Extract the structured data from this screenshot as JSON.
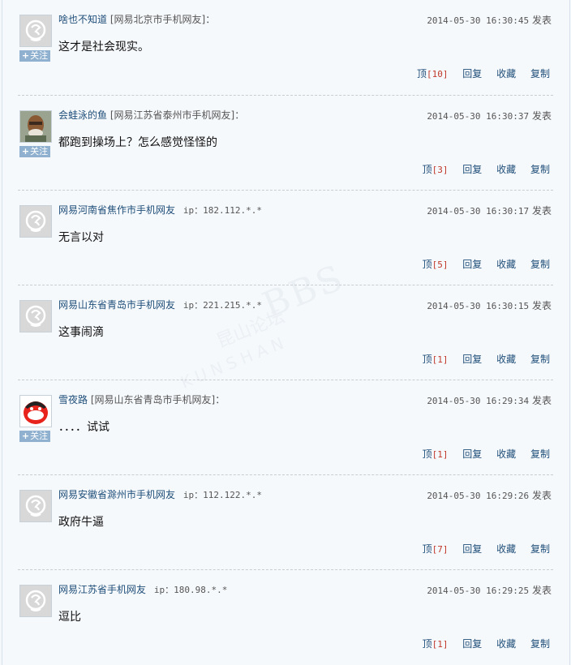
{
  "follow_label": "关注",
  "vote_label": "顶",
  "reply_label": "回复",
  "fav_label": "收藏",
  "copy_label": "复制",
  "post_suffix": "发表",
  "watermark": {
    "brand": "BBS",
    "cn": "昆山论坛",
    "en": "KUNSHAN"
  },
  "comments": [
    {
      "user": "啥也不知道",
      "loc": "[网易北京市手机网友]：",
      "ip": "",
      "time": "2014-05-30 16:30:45",
      "text": "这才是社会现实。",
      "votes": "10",
      "avatar": "default",
      "follow": true
    },
    {
      "user": "会蛙泳的鱼",
      "loc": "[网易江苏省泰州市手机网友]：",
      "ip": "",
      "time": "2014-05-30 16:30:37",
      "text": "都跑到操场上？怎么感觉怪怪的",
      "votes": "3",
      "avatar": "photo",
      "follow": true
    },
    {
      "user": "网易河南省焦作市手机网友",
      "loc": "",
      "ip": "ip：182.112.*.*",
      "time": "2014-05-30 16:30:17",
      "text": "无言以对",
      "votes": "5",
      "avatar": "default",
      "follow": false
    },
    {
      "user": "网易山东省青岛市手机网友",
      "loc": "",
      "ip": "ip：221.215.*.*",
      "time": "2014-05-30 16:30:15",
      "text": "这事闹滴",
      "votes": "1",
      "avatar": "default",
      "follow": false
    },
    {
      "user": "雪夜路",
      "loc": "[网易山东省青岛市手机网友]：",
      "ip": "",
      "time": "2014-05-30 16:29:34",
      "text": "．．．．试试",
      "votes": "1",
      "avatar": "qq",
      "follow": true
    },
    {
      "user": "网易安徽省滁州市手机网友",
      "loc": "",
      "ip": "ip：112.122.*.*",
      "time": "2014-05-30 16:29:26",
      "text": "政府牛逼",
      "votes": "7",
      "avatar": "default",
      "follow": false
    },
    {
      "user": "网易江苏省手机网友",
      "loc": "",
      "ip": "ip：180.98.*.*",
      "time": "2014-05-30 16:29:25",
      "text": "逗比",
      "votes": "1",
      "avatar": "default",
      "follow": false
    }
  ]
}
